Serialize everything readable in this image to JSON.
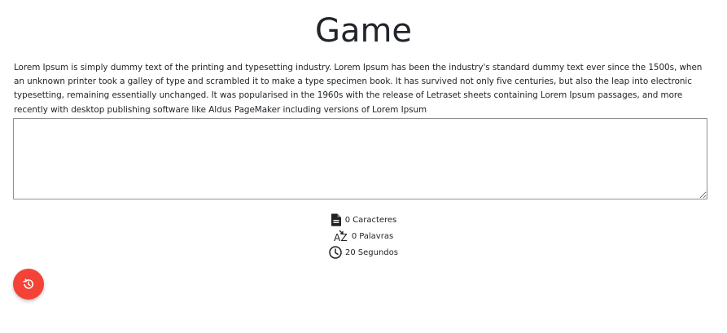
{
  "header": {
    "title": "Game"
  },
  "content": {
    "paragraph": "Lorem Ipsum is simply dummy text of the printing and typesetting industry. Lorem Ipsum has been the industry's standard dummy text ever since the 1500s, when an unknown printer took a galley of type and scrambled it to make a type specimen book. It has survived not only five centuries, but also the leap into electronic typesetting, remaining essentially unchanged. It was popularised in the 1960s with the release of Letraset sheets containing Lorem Ipsum passages, and more recently with desktop publishing software like Aldus PageMaker including versions of Lorem Ipsum"
  },
  "input": {
    "value": "",
    "placeholder": ""
  },
  "stats": {
    "characters": {
      "value": "0",
      "label": "Caracteres",
      "icon": "document-icon"
    },
    "words": {
      "value": "0",
      "label": "Palavras",
      "icon": "az-sort-icon"
    },
    "time": {
      "value": "20",
      "label": "Segundos",
      "icon": "clock-icon"
    }
  },
  "fab": {
    "icon": "history-icon",
    "color": "#f44336"
  }
}
